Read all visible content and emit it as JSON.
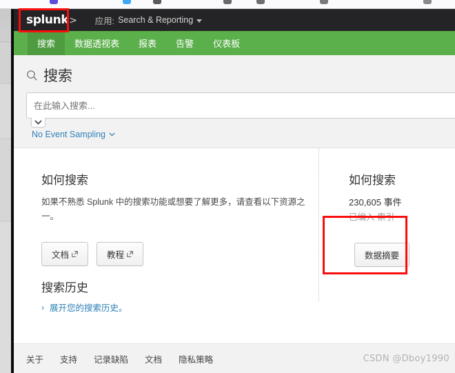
{
  "browser": {
    "favicon_colors": [
      "#5b4ddb",
      "#3da9f5",
      "#5a5a5a",
      "#6a6a6a",
      "#7a7a7a",
      "#8a8a8a"
    ]
  },
  "topbar": {
    "logo_text": "splunk",
    "logo_chevron": ">",
    "app_label": "应用:",
    "app_name": "Search & Reporting"
  },
  "nav": {
    "items": [
      {
        "label": "搜索",
        "active": true
      },
      {
        "label": "数据透视表",
        "active": false
      },
      {
        "label": "报表",
        "active": false
      },
      {
        "label": "告警",
        "active": false
      },
      {
        "label": "仪表板",
        "active": false
      }
    ]
  },
  "search": {
    "heading": "搜索",
    "input_value": "",
    "placeholder": "在此输入搜索...",
    "sampling_label": "No Event Sampling"
  },
  "main": {
    "left": {
      "title": "如何搜索",
      "description": "如果不熟悉 Splunk 中的搜索功能或想要了解更多，请查看以下资源之一。",
      "buttons": [
        {
          "label": "文档",
          "external": true
        },
        {
          "label": "教程",
          "external": true
        }
      ]
    },
    "right": {
      "title": "如何搜索",
      "event_count": "230,605 事件",
      "event_sub": "已编入 索引",
      "button_label": "数据摘要"
    },
    "history": {
      "title": "搜索历史",
      "link": "展开您的搜索历史。"
    }
  },
  "footer": {
    "links": [
      "关于",
      "支持",
      "记录缺陷",
      "文档",
      "隐私策略"
    ],
    "watermark": "CSDN @Dboy1990"
  },
  "colors": {
    "splunk_green": "#5cb04c",
    "splunk_green_active": "#4e9c3f",
    "topbar_black": "#242426",
    "link_blue": "#2f81b7",
    "annotation_red": "#fb0d0d"
  }
}
